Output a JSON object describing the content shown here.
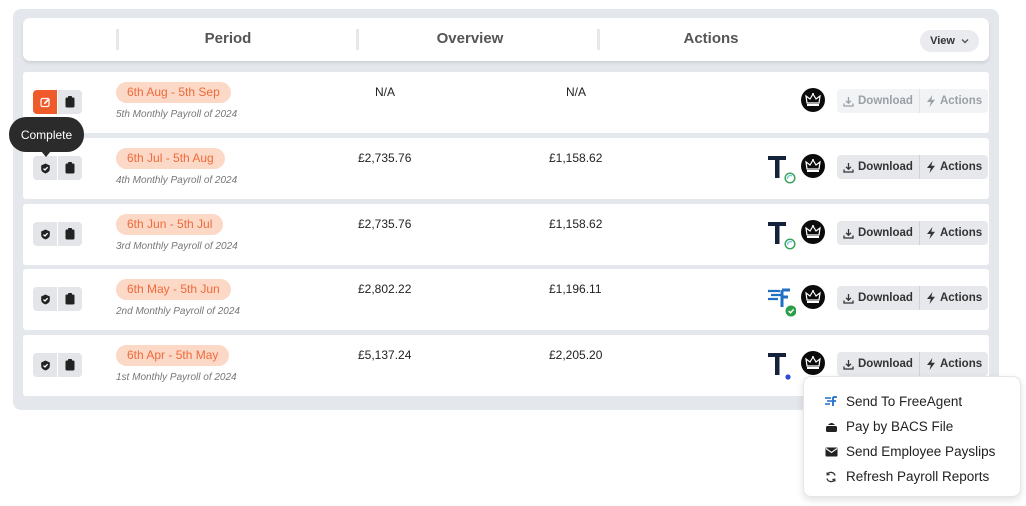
{
  "table": {
    "headers": {
      "period": "Period",
      "overview": "Overview",
      "actions": "Actions"
    },
    "view_button": {
      "label": "View"
    }
  },
  "tooltip": {
    "text": "Complete"
  },
  "rows": [
    {
      "period": "6th Aug - 5th Sep",
      "subtitle": "5th Monthly Payroll of 2024",
      "value1": "N/A",
      "value2": "N/A",
      "status": "edit",
      "integration": "none",
      "download_label": "Download",
      "actions_label": "Actions",
      "buttons_enabled": false
    },
    {
      "period": "6th Jul - 5th Aug",
      "subtitle": "4th Monthly Payroll of 2024",
      "value1": "£2,735.76",
      "value2": "£1,158.62",
      "status": "complete",
      "integration": "tapestry-pending",
      "download_label": "Download",
      "actions_label": "Actions",
      "buttons_enabled": true
    },
    {
      "period": "6th Jun - 5th Jul",
      "subtitle": "3rd Monthly Payroll of 2024",
      "value1": "£2,735.76",
      "value2": "£1,158.62",
      "status": "complete",
      "integration": "tapestry-pending",
      "download_label": "Download",
      "actions_label": "Actions",
      "buttons_enabled": true
    },
    {
      "period": "6th May - 5th Jun",
      "subtitle": "2nd Monthly Payroll of 2024",
      "value1": "£2,802.22",
      "value2": "£1,196.11",
      "status": "complete",
      "integration": "freeagent-synced",
      "download_label": "Download",
      "actions_label": "Actions",
      "buttons_enabled": true
    },
    {
      "period": "6th Apr - 5th May",
      "subtitle": "1st Monthly Payroll of 2024",
      "value1": "£5,137.24",
      "value2": "£2,205.20",
      "status": "complete",
      "integration": "tapestry",
      "download_label": "Download",
      "actions_label": "Actions",
      "buttons_enabled": true
    }
  ],
  "dropdown": {
    "items": [
      {
        "label": "Send To FreeAgent",
        "icon": "freeagent-icon"
      },
      {
        "label": "Pay by BACS File",
        "icon": "bank-icon"
      },
      {
        "label": "Send Employee Payslips",
        "icon": "envelope-icon"
      },
      {
        "label": "Refresh Payroll Reports",
        "icon": "refresh-icon"
      }
    ]
  },
  "colors": {
    "accent": "#ef5a2a",
    "badge_bg": "#fcd8c6",
    "badge_text": "#ef6a3c",
    "freeagent_blue": "#1f6fc5",
    "success_green": "#2e9d4a"
  }
}
